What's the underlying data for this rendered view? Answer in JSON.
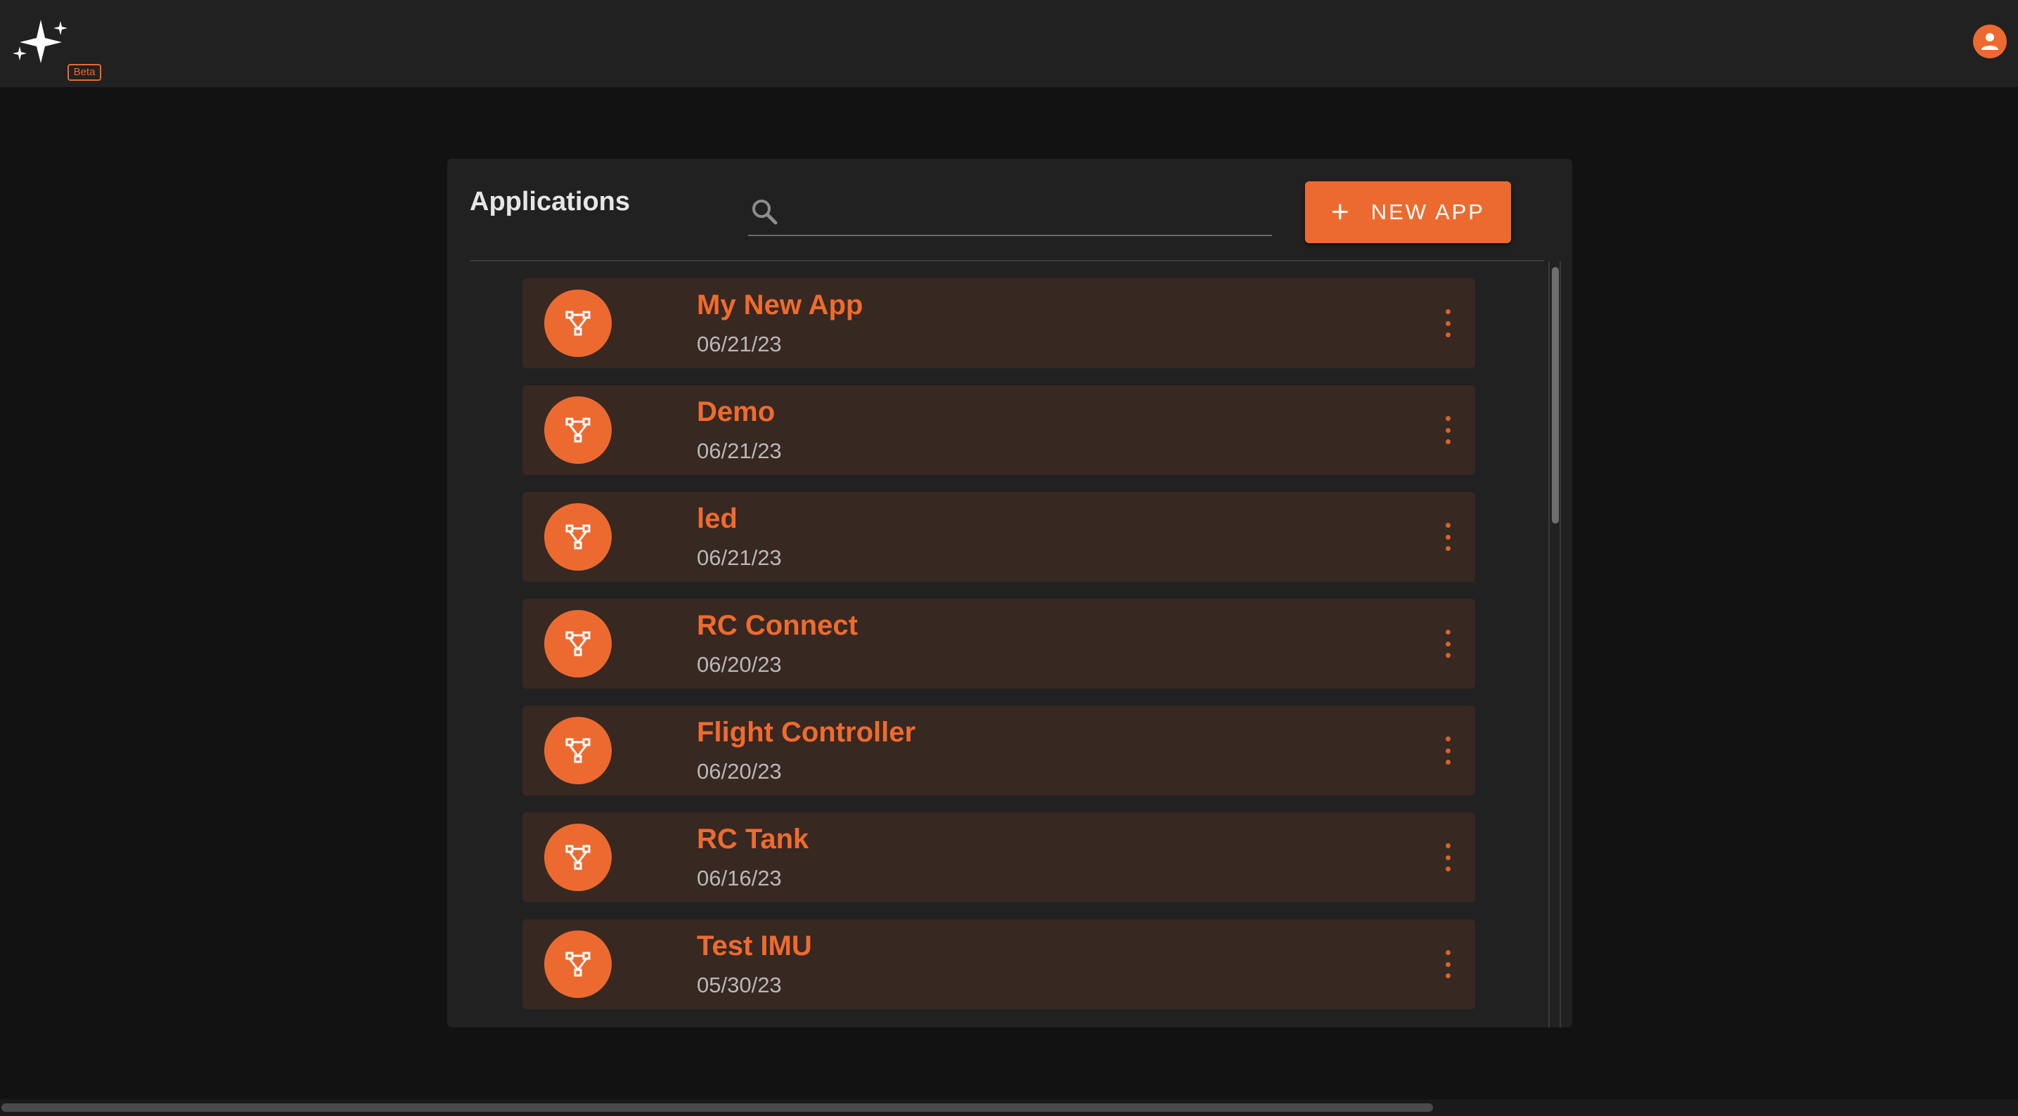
{
  "app": {
    "beta_label": "Beta"
  },
  "colors": {
    "accent": "#ec6a2f",
    "background": "#121212",
    "surface": "#212121",
    "list_item": "#382822"
  },
  "header": {
    "logo_icon": "sparkles-icon",
    "user_icon": "account-circle-icon"
  },
  "panel": {
    "title": "Applications",
    "search": {
      "value": "",
      "placeholder": "",
      "icon": "search-icon"
    },
    "new_app_button": {
      "label": "NEW APP",
      "icon": "plus-icon"
    }
  },
  "applications": [
    {
      "name": "My New App",
      "date": "06/21/23",
      "icon": "flow-graph-icon",
      "menu_icon": "more-vert-icon"
    },
    {
      "name": "Demo",
      "date": "06/21/23",
      "icon": "flow-graph-icon",
      "menu_icon": "more-vert-icon"
    },
    {
      "name": "led",
      "date": "06/21/23",
      "icon": "flow-graph-icon",
      "menu_icon": "more-vert-icon"
    },
    {
      "name": "RC Connect",
      "date": "06/20/23",
      "icon": "flow-graph-icon",
      "menu_icon": "more-vert-icon"
    },
    {
      "name": "Flight Controller",
      "date": "06/20/23",
      "icon": "flow-graph-icon",
      "menu_icon": "more-vert-icon"
    },
    {
      "name": "RC Tank",
      "date": "06/16/23",
      "icon": "flow-graph-icon",
      "menu_icon": "more-vert-icon"
    },
    {
      "name": "Test IMU",
      "date": "05/30/23",
      "icon": "flow-graph-icon",
      "menu_icon": "more-vert-icon"
    }
  ]
}
